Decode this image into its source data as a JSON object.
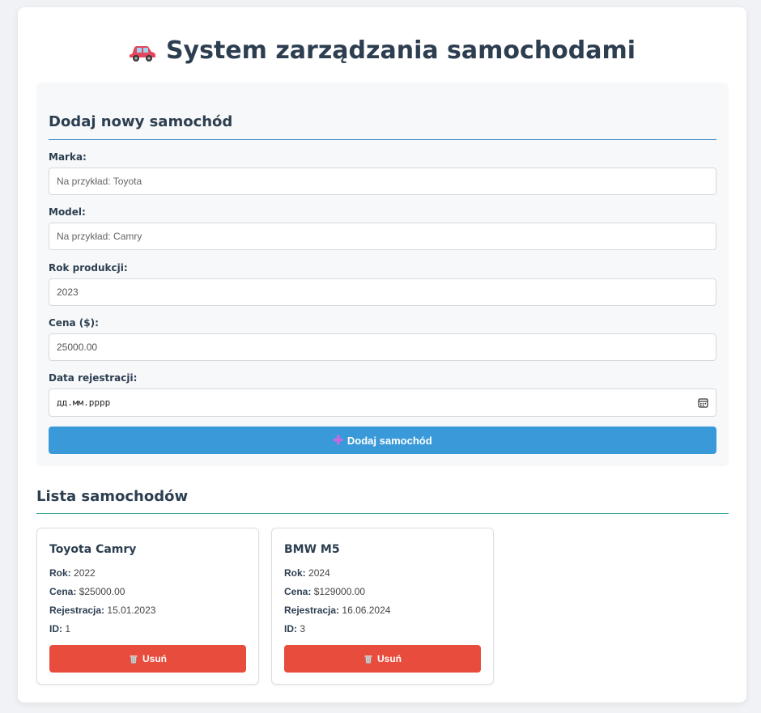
{
  "header": {
    "title": "System zarządzania samochodami",
    "icon": "car-icon"
  },
  "form": {
    "title": "Dodaj nowy samochód",
    "fields": [
      {
        "label": "Marka:",
        "placeholder": "Na przykład: Toyota",
        "value": ""
      },
      {
        "label": "Model:",
        "placeholder": "Na przykład: Camry",
        "value": ""
      },
      {
        "label": "Rok produkcji:",
        "placeholder": "",
        "value": "2023"
      },
      {
        "label": "Cena ($):",
        "placeholder": "",
        "value": "25000.00"
      },
      {
        "label": "Data rejestracji:",
        "placeholder": "дд.мм.рррр",
        "value": "дд.мм.рррр"
      }
    ],
    "submit_label": "Dodaj samochód",
    "submit_icon": "plus-icon"
  },
  "list": {
    "title": "Lista samochodów",
    "cars": [
      {
        "name": "Toyota Camry",
        "year_label": "Rok:",
        "year": "2022",
        "price_label": "Cena:",
        "price": "$25000.00",
        "reg_label": "Rejestracja:",
        "reg": "15.01.2023",
        "id_label": "ID:",
        "id": "1",
        "delete_label": "Usuń"
      },
      {
        "name": "BMW M5",
        "year_label": "Rok:",
        "year": "2024",
        "price_label": "Cena:",
        "price": "$129000.00",
        "reg_label": "Rejestracja:",
        "reg": "16.06.2024",
        "id_label": "ID:",
        "id": "3",
        "delete_label": "Usuń"
      }
    ]
  },
  "colors": {
    "primary": "#3a9ad9",
    "danger": "#e74c3c",
    "text": "#2c3e50"
  }
}
